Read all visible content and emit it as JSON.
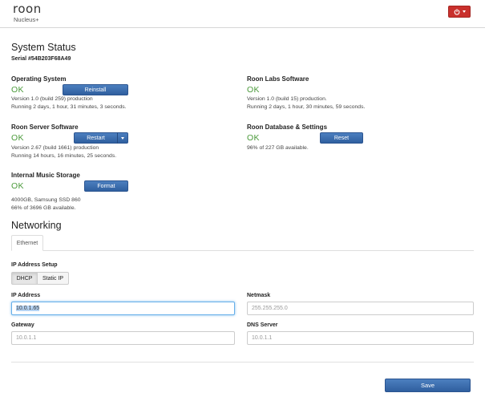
{
  "header": {
    "logo": "roon",
    "device": "Nucleus+"
  },
  "system_status": {
    "title": "System Status",
    "serial": "Serial #54B203F68A49",
    "operating_system": {
      "title": "Operating System",
      "status": "OK",
      "button": "Reinstall",
      "lines": [
        "Version 1.0 (build 259) production",
        "Running 2 days, 1 hour, 31 minutes, 3 seconds."
      ]
    },
    "roon_labs_software": {
      "title": "Roon Labs Software",
      "status": "OK",
      "lines": [
        "Version 1.0 (build 15) production.",
        "Running 2 days, 1 hour, 30 minutes, 59 seconds."
      ]
    },
    "roon_server_software": {
      "title": "Roon Server Software",
      "status": "OK",
      "button": "Restart",
      "lines": [
        "Version 2.67 (build 1661) production",
        "Running 14 hours, 16 minutes, 25 seconds."
      ]
    },
    "roon_database": {
      "title": "Roon Database & Settings",
      "status": "OK",
      "button": "Reset",
      "lines": [
        "96% of 227 GB available."
      ]
    },
    "internal_storage": {
      "title": "Internal Music Storage",
      "status": "OK",
      "button": "Format",
      "lines": [
        "4000GB, Samsung SSD 860",
        "66% of 3696 GB available."
      ]
    }
  },
  "networking": {
    "title": "Networking",
    "tab": "Ethernet",
    "ip_setup_label": "IP Address Setup",
    "dhcp_label": "DHCP",
    "static_label": "Static IP",
    "ip_address_label": "IP Address",
    "ip_address_value": "10.0.1.65",
    "netmask_label": "Netmask",
    "netmask_value": "255.255.255.0",
    "gateway_label": "Gateway",
    "gateway_value": "10.0.1.1",
    "dns_label": "DNS Server",
    "dns_value": "10.0.1.1",
    "save_label": "Save"
  },
  "colors": {
    "ok_green": "#4a9a3a",
    "primary_blue": "#2f5f9f",
    "power_red": "#c9302c"
  }
}
